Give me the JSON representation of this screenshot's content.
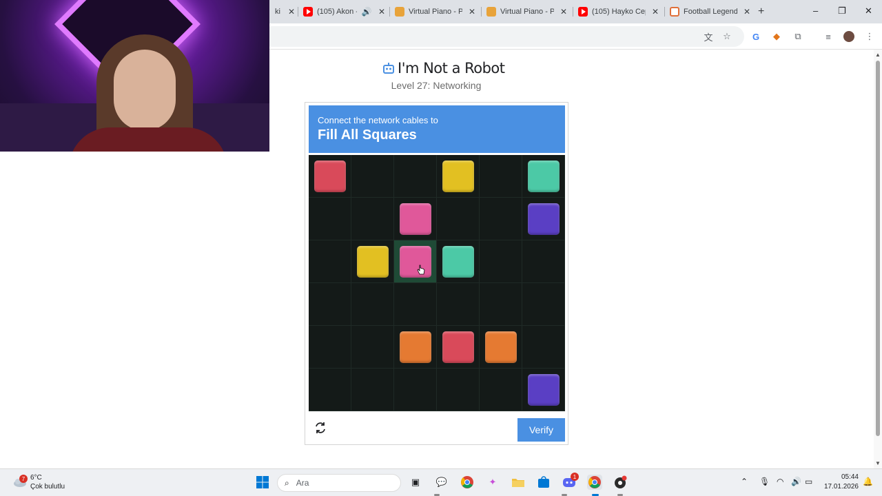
{
  "browser": {
    "tabs": [
      {
        "title": "ki",
        "icon": "partial-tab-icon"
      },
      {
        "title": "(105) Akon -",
        "icon": "youtube-icon",
        "audio": true
      },
      {
        "title": "Virtual Piano - Pl",
        "icon": "virtual-piano-icon"
      },
      {
        "title": "Virtual Piano - Pl",
        "icon": "virtual-piano-icon"
      },
      {
        "title": "(105) Hayko Cep",
        "icon": "youtube-icon"
      },
      {
        "title": "Football Legend",
        "icon": "football-icon"
      }
    ],
    "new_tab": "+",
    "window_controls": [
      "–",
      "❐",
      "✕"
    ]
  },
  "page": {
    "title": "I'm Not a Robot",
    "level": "Level 27: Networking"
  },
  "captcha": {
    "instruction": "Connect the network cables to",
    "goal": "Fill All Squares",
    "verify_label": "Verify",
    "grid": [
      [
        "red",
        null,
        null,
        "yellow",
        null,
        "teal"
      ],
      [
        null,
        null,
        "pink",
        null,
        null,
        "purple"
      ],
      [
        null,
        "yellow",
        "pink",
        "teal",
        null,
        null
      ],
      [
        null,
        null,
        null,
        null,
        null,
        null
      ],
      [
        null,
        null,
        "orange",
        "red",
        "orange",
        null
      ],
      [
        null,
        null,
        null,
        null,
        null,
        "purple"
      ]
    ],
    "highlighted_cell": [
      2,
      2
    ],
    "colors": {
      "red": "#d94a5a",
      "yellow": "#e2c022",
      "teal": "#4cc9a6",
      "pink": "#e0589a",
      "purple": "#5a3fc4",
      "orange": "#e57a32"
    }
  },
  "taskbar": {
    "weather_badge": "7",
    "weather_temp": "6°C",
    "weather_desc": "Çok bulutlu",
    "search_placeholder": "Ara",
    "discord_badge": "1",
    "time": "05:44",
    "date": "17.01.2026"
  }
}
